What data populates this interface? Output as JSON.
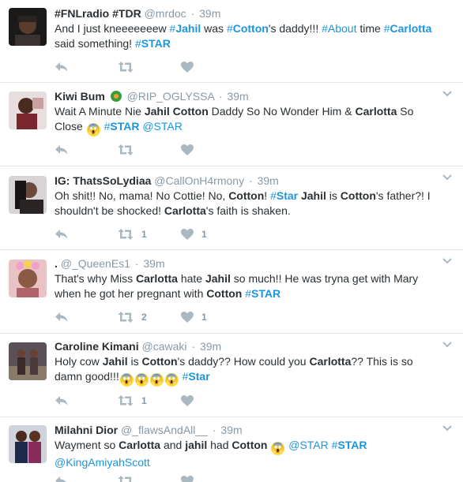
{
  "tweets": [
    {
      "name": "#FNLradio #TDR",
      "handle": "@mrdoc",
      "time": "39m",
      "segments": [
        {
          "t": "And I just kneeeeeeew ",
          "s": "n"
        },
        {
          "t": "#",
          "s": "tag"
        },
        {
          "t": "Jahil",
          "s": "tagb"
        },
        {
          "t": " was ",
          "s": "n"
        },
        {
          "t": "#",
          "s": "tag"
        },
        {
          "t": "Cotton",
          "s": "tagb"
        },
        {
          "t": "'s daddy!!! ",
          "s": "n"
        },
        {
          "t": "#About",
          "s": "tag"
        },
        {
          "t": " time ",
          "s": "n"
        },
        {
          "t": "#",
          "s": "tag"
        },
        {
          "t": "Carlotta",
          "s": "tagb"
        },
        {
          "t": " said something! ",
          "s": "n"
        },
        {
          "t": "#",
          "s": "tag"
        },
        {
          "t": "STAR",
          "s": "tagb"
        }
      ],
      "retweets": "",
      "likes": ""
    },
    {
      "name": "Kiwi Bum",
      "badge_icon": "emoji-badge-icon",
      "handle": "@RIP_OGLYSSA",
      "time": "39m",
      "segments": [
        {
          "t": "Wait A Minute Nie ",
          "s": "n"
        },
        {
          "t": "Jahil Cotton",
          "s": "b"
        },
        {
          "t": " Daddy So No Wonder Him & ",
          "s": "n"
        },
        {
          "t": "Carlotta",
          "s": "b"
        },
        {
          "t": " So Close ",
          "s": "n"
        },
        {
          "t": "😱",
          "s": "em"
        },
        {
          "t": " ",
          "s": "n"
        },
        {
          "t": "#",
          "s": "tag"
        },
        {
          "t": "STAR",
          "s": "tagb"
        },
        {
          "t": " @STAR",
          "s": "tag"
        }
      ],
      "retweets": "",
      "likes": ""
    },
    {
      "name": "IG: ThatsSoLydiaa",
      "handle": "@CallOnH4rmony",
      "time": "39m",
      "segments": [
        {
          "t": "Oh shit!! No, mama! No Cottie! No, ",
          "s": "n"
        },
        {
          "t": "Cotton",
          "s": "b"
        },
        {
          "t": "! ",
          "s": "n"
        },
        {
          "t": "#",
          "s": "tag"
        },
        {
          "t": "Star",
          "s": "tagb"
        },
        {
          "t": " ",
          "s": "n"
        },
        {
          "t": "Jahil",
          "s": "b"
        },
        {
          "t": " is ",
          "s": "n"
        },
        {
          "t": "Cotton",
          "s": "b"
        },
        {
          "t": "'s father?! I shouldn't be shocked! ",
          "s": "n"
        },
        {
          "t": "Carlotta",
          "s": "b"
        },
        {
          "t": "'s faith is shaken.",
          "s": "n"
        }
      ],
      "retweets": "1",
      "likes": "1"
    },
    {
      "name": ".",
      "handle": "@_QueenEs1",
      "time": "39m",
      "segments": [
        {
          "t": "That's why Miss ",
          "s": "n"
        },
        {
          "t": "Carlotta",
          "s": "b"
        },
        {
          "t": " hate ",
          "s": "n"
        },
        {
          "t": "Jahil",
          "s": "b"
        },
        {
          "t": " so much!! He was tryna get with Mary when he got her pregnant with ",
          "s": "n"
        },
        {
          "t": "Cotton",
          "s": "b"
        },
        {
          "t": " ",
          "s": "n"
        },
        {
          "t": "#",
          "s": "tag"
        },
        {
          "t": "STAR",
          "s": "tagb"
        }
      ],
      "retweets": "2",
      "likes": "1"
    },
    {
      "name": "Caroline Kimani",
      "handle": "@cawaki",
      "time": "39m",
      "segments": [
        {
          "t": "Holy cow ",
          "s": "n"
        },
        {
          "t": "Jahil",
          "s": "b"
        },
        {
          "t": " is ",
          "s": "n"
        },
        {
          "t": "Cotton",
          "s": "b"
        },
        {
          "t": "'s daddy?? How could you ",
          "s": "n"
        },
        {
          "t": "Carlotta",
          "s": "b"
        },
        {
          "t": "?? This is so damn good!!!",
          "s": "n"
        },
        {
          "t": "😱",
          "s": "em"
        },
        {
          "t": "😱",
          "s": "em"
        },
        {
          "t": "😱",
          "s": "em"
        },
        {
          "t": "😱",
          "s": "em"
        },
        {
          "t": " ",
          "s": "n"
        },
        {
          "t": "#",
          "s": "tag"
        },
        {
          "t": "Star",
          "s": "tagb"
        }
      ],
      "retweets": "1",
      "likes": ""
    },
    {
      "name": "Milahni Dior",
      "handle": "@_flawsAndAll__",
      "time": "39m",
      "segments": [
        {
          "t": "Wayment so ",
          "s": "n"
        },
        {
          "t": "Carlotta",
          "s": "b"
        },
        {
          "t": " and ",
          "s": "n"
        },
        {
          "t": "jahil",
          "s": "b"
        },
        {
          "t": " had ",
          "s": "n"
        },
        {
          "t": "Cotton",
          "s": "b"
        },
        {
          "t": " ",
          "s": "n"
        },
        {
          "t": "😱",
          "s": "em"
        },
        {
          "t": " @STAR ",
          "s": "tag"
        },
        {
          "t": "#",
          "s": "tag"
        },
        {
          "t": "STAR",
          "s": "tagb"
        },
        {
          "t": " @KingAmiyahScott",
          "s": "tag"
        }
      ],
      "retweets": "",
      "likes": ""
    }
  ],
  "icons": {
    "reply": "reply-icon",
    "retweet": "retweet-icon",
    "like": "heart-icon",
    "more": "chevron-down-icon"
  },
  "colors": {
    "link": "#1b95e0",
    "text": "#292f33",
    "muted": "#8899a6",
    "action": "#aab8c2",
    "border": "#e1e8ed"
  }
}
